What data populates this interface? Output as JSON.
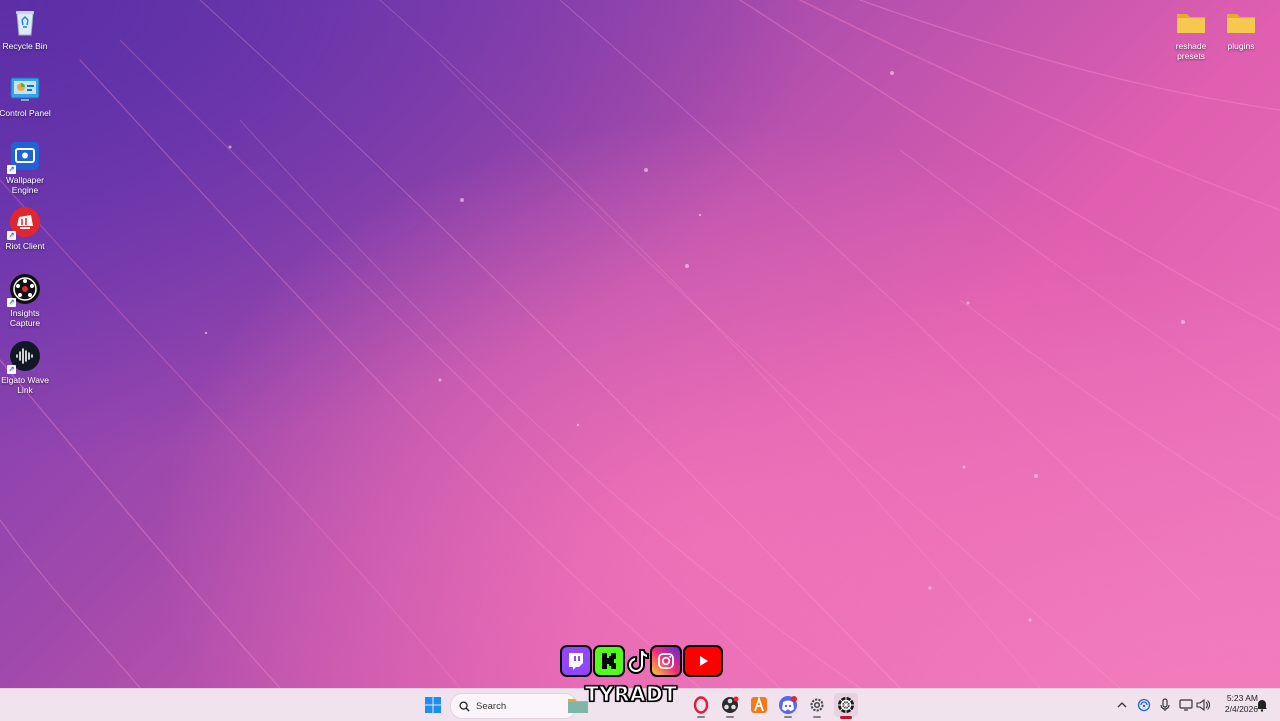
{
  "desktop": {
    "left_icons": [
      {
        "name": "recycle-bin",
        "label": "Recycle Bin"
      },
      {
        "name": "control-panel",
        "label": "Control Panel"
      },
      {
        "name": "wallpaper-engine",
        "label": "Wallpaper Engine"
      },
      {
        "name": "riot-client",
        "label": "Riot Client"
      },
      {
        "name": "insights-capture",
        "label": "Insights Capture"
      },
      {
        "name": "elgato-wave-link",
        "label": "Elgato Wave Link"
      }
    ],
    "right_icons": [
      {
        "name": "reshade-presets-folder",
        "label": "reshade presets"
      },
      {
        "name": "plugins-folder",
        "label": "plugins"
      }
    ]
  },
  "overlay": {
    "brand_name": "TYRADT",
    "socials": [
      "twitch-icon",
      "kick-icon",
      "tiktok-icon",
      "instagram-icon",
      "youtube-icon"
    ]
  },
  "taskbar": {
    "search_placeholder": "Search",
    "pinned_apps": [
      "start-icon",
      "file-explorer-icon",
      "opera-gx-icon",
      "obs-icon",
      "arc-app-icon",
      "discord-icon",
      "settings-icon",
      "steelseries-icon"
    ]
  },
  "tray": {
    "icons": [
      "chevron-up-icon",
      "network-icon",
      "microphone-icon",
      "display-icon",
      "speaker-icon"
    ],
    "time": "5:23 AM",
    "date": "2/4/2026"
  },
  "colors": {
    "wallpaper_top": "#6a38b6",
    "wallpaper_bottom": "#ee78bd",
    "taskbar": "#f1e3ee",
    "folder": "#f3c04a"
  }
}
